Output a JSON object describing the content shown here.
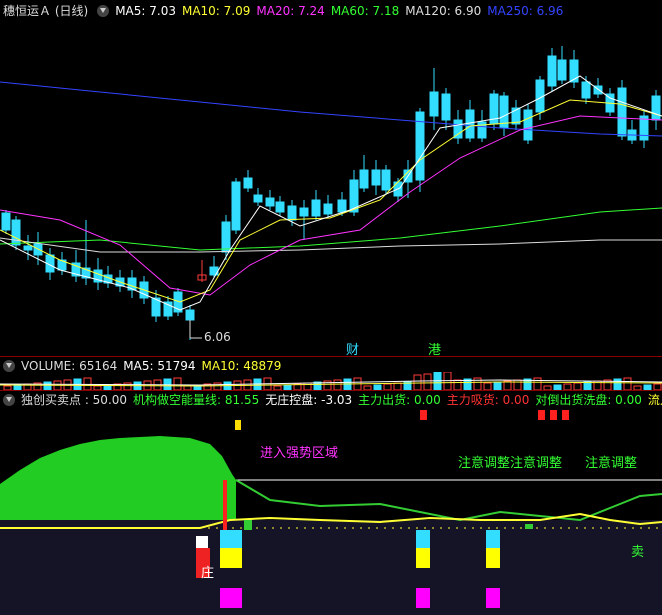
{
  "price": {
    "title": "穗恒运Ａ (日线)",
    "indicators": [
      {
        "text": "MA5: 7.03",
        "color": "#ffffff"
      },
      {
        "text": "MA10: 7.09",
        "color": "#ffff33"
      },
      {
        "text": "MA20: 7.24",
        "color": "#ff33ff"
      },
      {
        "text": "MA60: 7.18",
        "color": "#33ff33"
      },
      {
        "text": "MA120: 6.90",
        "color": "#dddddd"
      },
      {
        "text": "MA250: 6.96",
        "color": "#3344ff"
      }
    ],
    "low_marker": "6.06",
    "tag_cai": "财",
    "tag_gang": "港"
  },
  "volume": {
    "indicators": [
      {
        "text": "VOLUME: 65164",
        "color": "#dddddd"
      },
      {
        "text": "MA5: 51794",
        "color": "#ffffff"
      },
      {
        "text": "MA10: 48879",
        "color": "#ffff33"
      }
    ]
  },
  "signal": {
    "indicators": [
      {
        "text": "独创买卖点 : 50.00",
        "color": "#dddddd"
      },
      {
        "text": "机构做空能量线: 81.55",
        "color": "#33ff33"
      },
      {
        "text": "无庄控盘: -3.03",
        "color": "#ffffff"
      },
      {
        "text": "主力出货: 0.00",
        "color": "#33ff33"
      },
      {
        "text": "主力吸货: 0.00",
        "color": "#ff3333"
      },
      {
        "text": "对倒出货洗盘: 0.00",
        "color": "#33ff33"
      },
      {
        "text": "流入强度:",
        "color": "#ffff33"
      }
    ],
    "strong_zone": "进入强势区域",
    "adjust1": "注意调整注意调整",
    "adjust2": "注意调整",
    "zhuang": "庄",
    "sell": "卖"
  }
}
